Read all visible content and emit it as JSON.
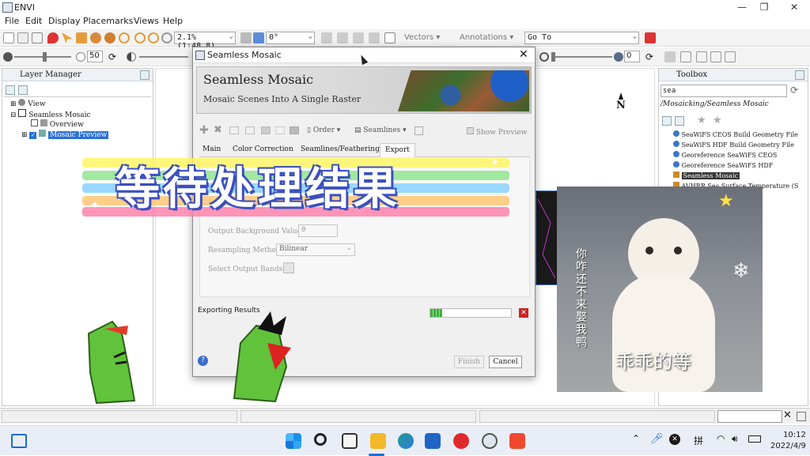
{
  "window": {
    "title": "ENVI"
  },
  "menu": [
    "File",
    "Edit",
    "Display",
    "Placemarks",
    "Views",
    "Help"
  ],
  "toolbar": {
    "zoom_value": "2.1% (1:48.8)",
    "rotation_value": "0°",
    "vectors_label": "Vectors",
    "annotations_label": "Annotations",
    "goto_value": "Go To",
    "brightness_value": "50",
    "stretch_value": "0"
  },
  "layer_manager": {
    "title": "Layer Manager",
    "items": [
      "View",
      "Seamless Mosaic",
      "Overview",
      "Mosaic Preview"
    ]
  },
  "toolbox": {
    "title": "Toolbox",
    "search_value": "sea",
    "path": "/Mosaicking/Seamless Mosaic",
    "items": [
      "SeaWiFS CEOS Build Geometry File",
      "SeaWiFS HDF Build Geometry File",
      "Georeference SeaWiFS CEOS",
      "Georeference SeaWiFS HDF",
      "Seamless Mosaic",
      "AVHRR Sea Surface Temperature (S"
    ]
  },
  "north_label": "N",
  "dialog": {
    "window_title": "Seamless Mosaic",
    "banner_title": "Seamless Mosaic",
    "banner_subtitle": "Mosaic Scenes Into A Single Raster",
    "order_label": "Order",
    "seamlines_label": "Seamlines",
    "show_preview_label": "Show Preview",
    "tabs": [
      "Main",
      "Color Correction",
      "Seamlines/Feathering",
      "Export"
    ],
    "output_bg_label": "Output Background Value",
    "output_bg_value": "0",
    "resampling_label": "Resampling Method",
    "resampling_value": "Bilinear",
    "select_bands_label": "Select Output Bands",
    "exporting_label": "Exporting Results",
    "progress": 0.15,
    "finish_label": "Finish",
    "cancel_label": "Cancel"
  },
  "overlay": {
    "banner_text": "等待处理结果",
    "cat_side_text": "你咋还不来娶我鸭",
    "cat_bottom_text": "乖乖的等"
  },
  "taskbar": {
    "ime": "拼",
    "time": "10:12",
    "date": "2022/4/9"
  }
}
